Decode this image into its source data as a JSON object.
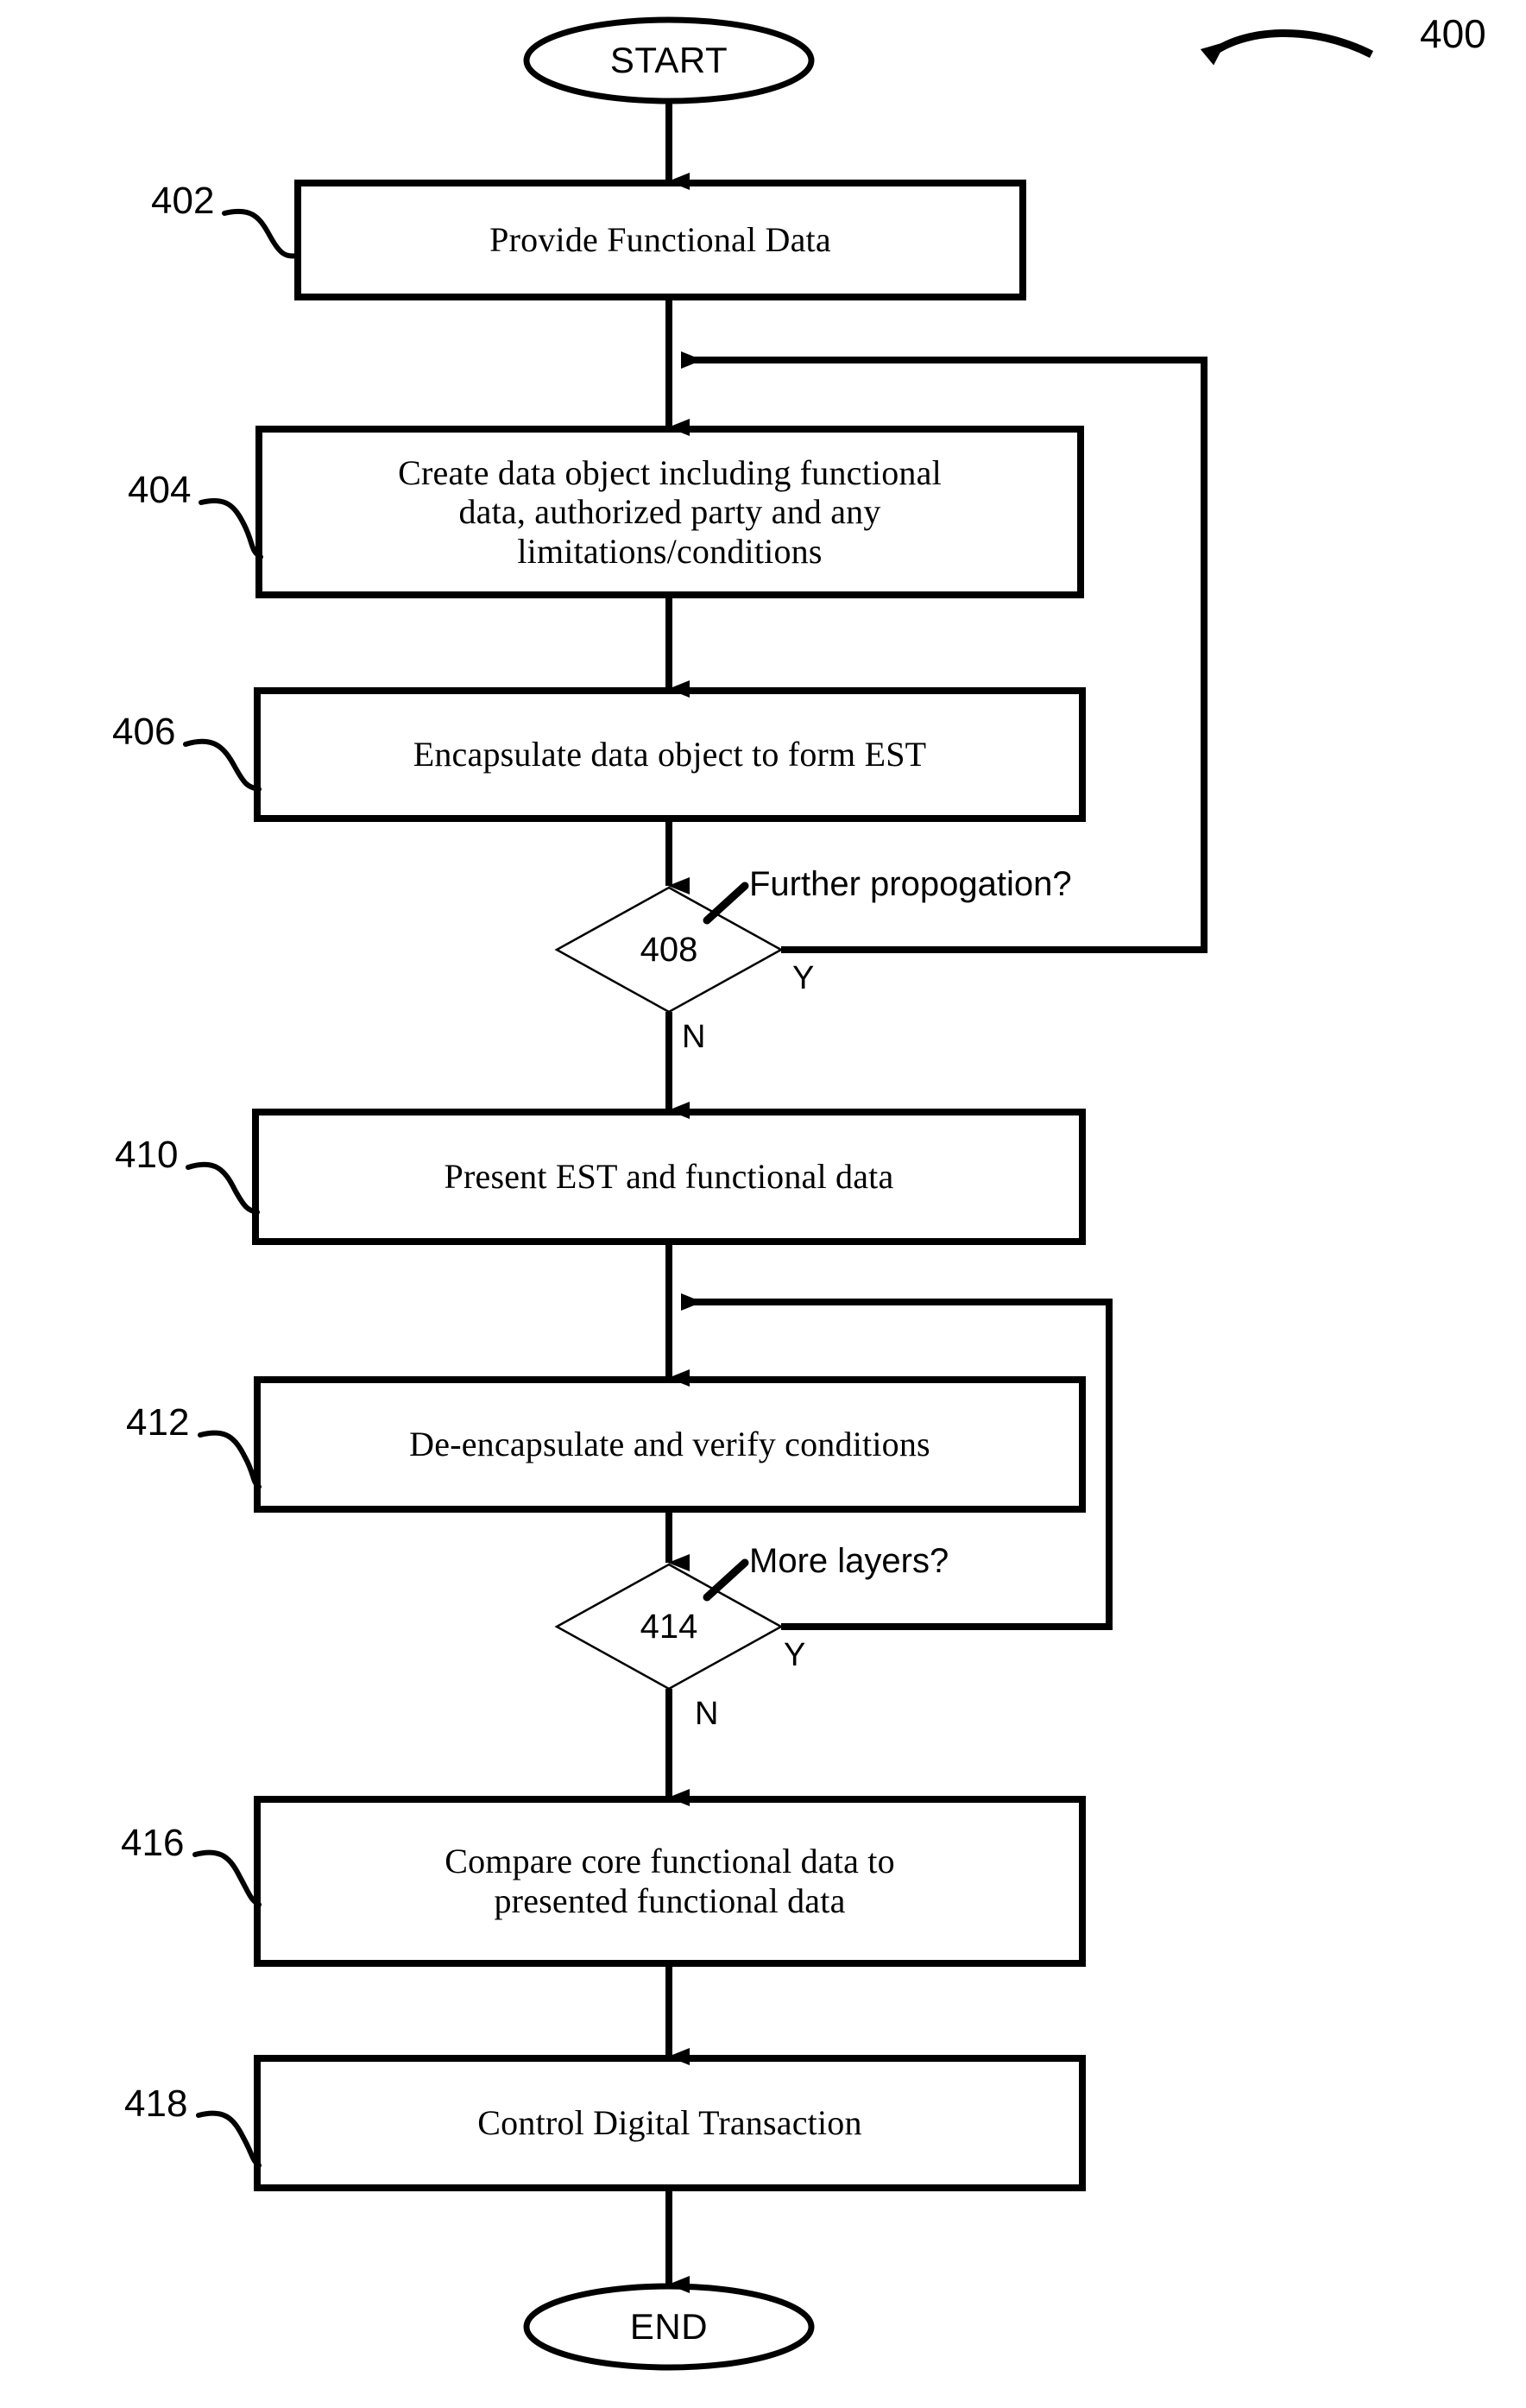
{
  "figure": {
    "number": "400",
    "type": "flowchart"
  },
  "terminals": {
    "start": "START",
    "end": "END"
  },
  "steps": [
    {
      "ref": "402",
      "text": "Provide Functional Data"
    },
    {
      "ref": "404",
      "line1": "Create data object including functional",
      "line2": "data, authorized party and any",
      "line3": "limitations/conditions"
    },
    {
      "ref": "406",
      "text": "Encapsulate data object to form EST"
    },
    {
      "ref": "410",
      "text": "Present EST and functional data"
    },
    {
      "ref": "412",
      "text": "De-encapsulate and verify conditions"
    },
    {
      "ref": "416",
      "line1": "Compare core functional data to",
      "line2": "presented functional data"
    },
    {
      "ref": "418",
      "text": "Control Digital Transaction"
    }
  ],
  "decisions": [
    {
      "ref": "408",
      "question": "Further propogation?",
      "yes": "Y",
      "no": "N"
    },
    {
      "ref": "414",
      "question": "More layers?",
      "yes": "Y",
      "no": "N"
    }
  ],
  "colors": {
    "stroke": "#000000",
    "fill": "#ffffff",
    "thin_stroke": "#000000"
  }
}
